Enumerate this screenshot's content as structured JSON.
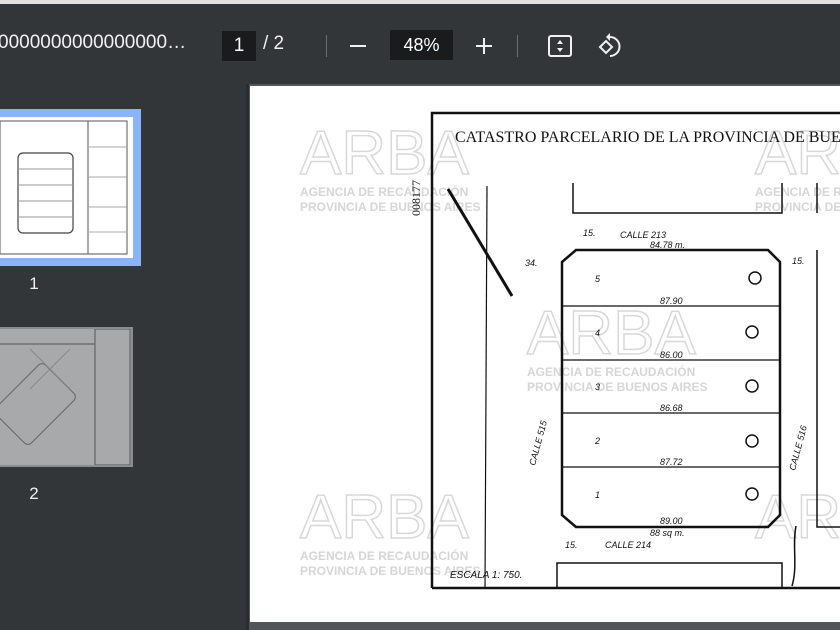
{
  "toolbar": {
    "filename": "0000000000000000…",
    "current_page": "1",
    "page_total": "/ 2",
    "zoom": "48%",
    "icons": [
      "minus-icon",
      "plus-icon",
      "fit-page-icon",
      "rotate-icon"
    ]
  },
  "sidebar": {
    "thumbnails": [
      {
        "label": "1",
        "selected": true
      },
      {
        "label": "2",
        "selected": false
      }
    ],
    "accent": "#8ab4f8"
  },
  "document": {
    "title": "CATASTRO PARCELARIO DE LA PROVINCIA DE BUENOS AIRES",
    "number": "008177",
    "street_top": "CALLE 213",
    "street_bottom": "CALLE 214",
    "street_left": "CALLE 515",
    "street_right": "CALLE 516",
    "dim_top": "84.78 m.",
    "dim_bottom": "88 sq m.",
    "corner_top_left": "34.",
    "corner_top_right": "15.",
    "corner_top_mid": "15.",
    "corner_bottom": "15.",
    "scale": "ESCALA 1: 750.",
    "lot_labels": [
      "5",
      "4",
      "3",
      "2",
      "1"
    ],
    "lot_dims": [
      "87.90",
      "86.00",
      "86.68",
      "87.72",
      "89.00"
    ],
    "watermark": {
      "logo": "ARBA",
      "line1": "AGENCIA DE RECAUDACIÓN",
      "line2": "PROVINCIA DE BUENOS AIRES"
    }
  }
}
